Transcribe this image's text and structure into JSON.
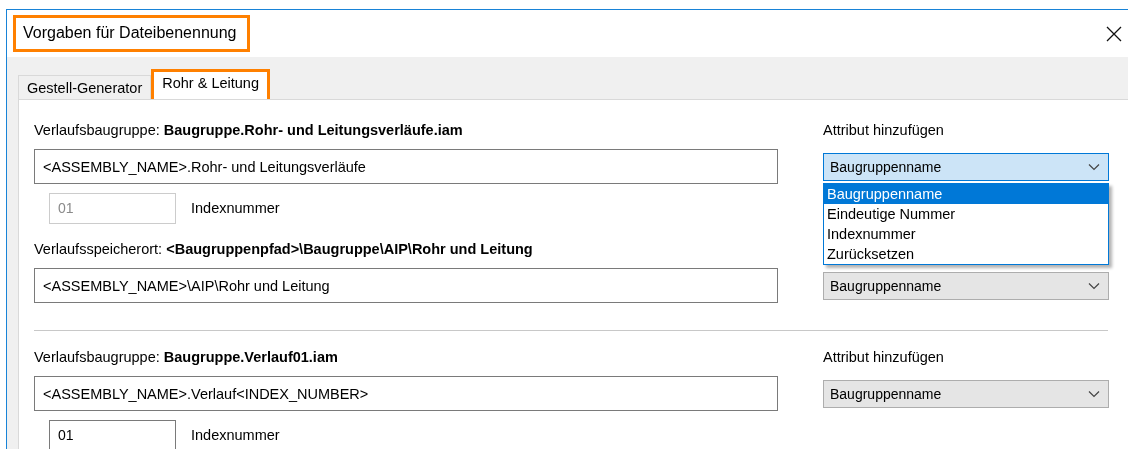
{
  "window": {
    "title": "Vorgaben für Dateibenennung",
    "highlighted": true
  },
  "tabs": [
    {
      "label": "Gestell-Generator",
      "selected": false,
      "highlighted": false
    },
    {
      "label": "Rohr & Leitung",
      "selected": true,
      "highlighted": true
    }
  ],
  "sections": [
    {
      "divider_before": false,
      "label": "Verlaufsbaugruppe: **Baugruppe.Rohr- und Leitungsverläufe.iam**",
      "name": "<ASSEMBLY_NAME>.Rohr- und Leitungsverläufe",
      "attribute_label": "Attribut hinzufügen",
      "combo": {
        "value": "Baugruppenname",
        "open": true,
        "options": [
          {
            "label": "Baugruppenname",
            "selected": true
          },
          {
            "label": "Eindeutige Nummer",
            "selected": false
          },
          {
            "label": "Indexnummer",
            "selected": false
          },
          {
            "label": "Zurücksetzen",
            "selected": false
          }
        ]
      },
      "index": {
        "value": "01",
        "label": "Indexnummer",
        "disabled": true
      }
    },
    {
      "divider_before": false,
      "label": "Verlaufsspeicherort: **<Baugruppenpfad>\\Baugruppe\\AIP\\Rohr und Leitung**",
      "name": "<ASSEMBLY_NAME>\\AIP\\Rohr und Leitung",
      "combo": {
        "value": "Baugruppenname",
        "open": false
      }
    },
    {
      "divider_before": true,
      "label": "Verlaufsbaugruppe: **Baugruppe.Verlauf01.iam**",
      "name": "<ASSEMBLY_NAME>.Verlauf<INDEX_NUMBER>",
      "attribute_label": "Attribut hinzufügen",
      "combo": {
        "value": "Baugruppenname",
        "open": false
      },
      "index": {
        "value": "01",
        "label": "Indexnummer",
        "disabled": false
      }
    }
  ]
}
